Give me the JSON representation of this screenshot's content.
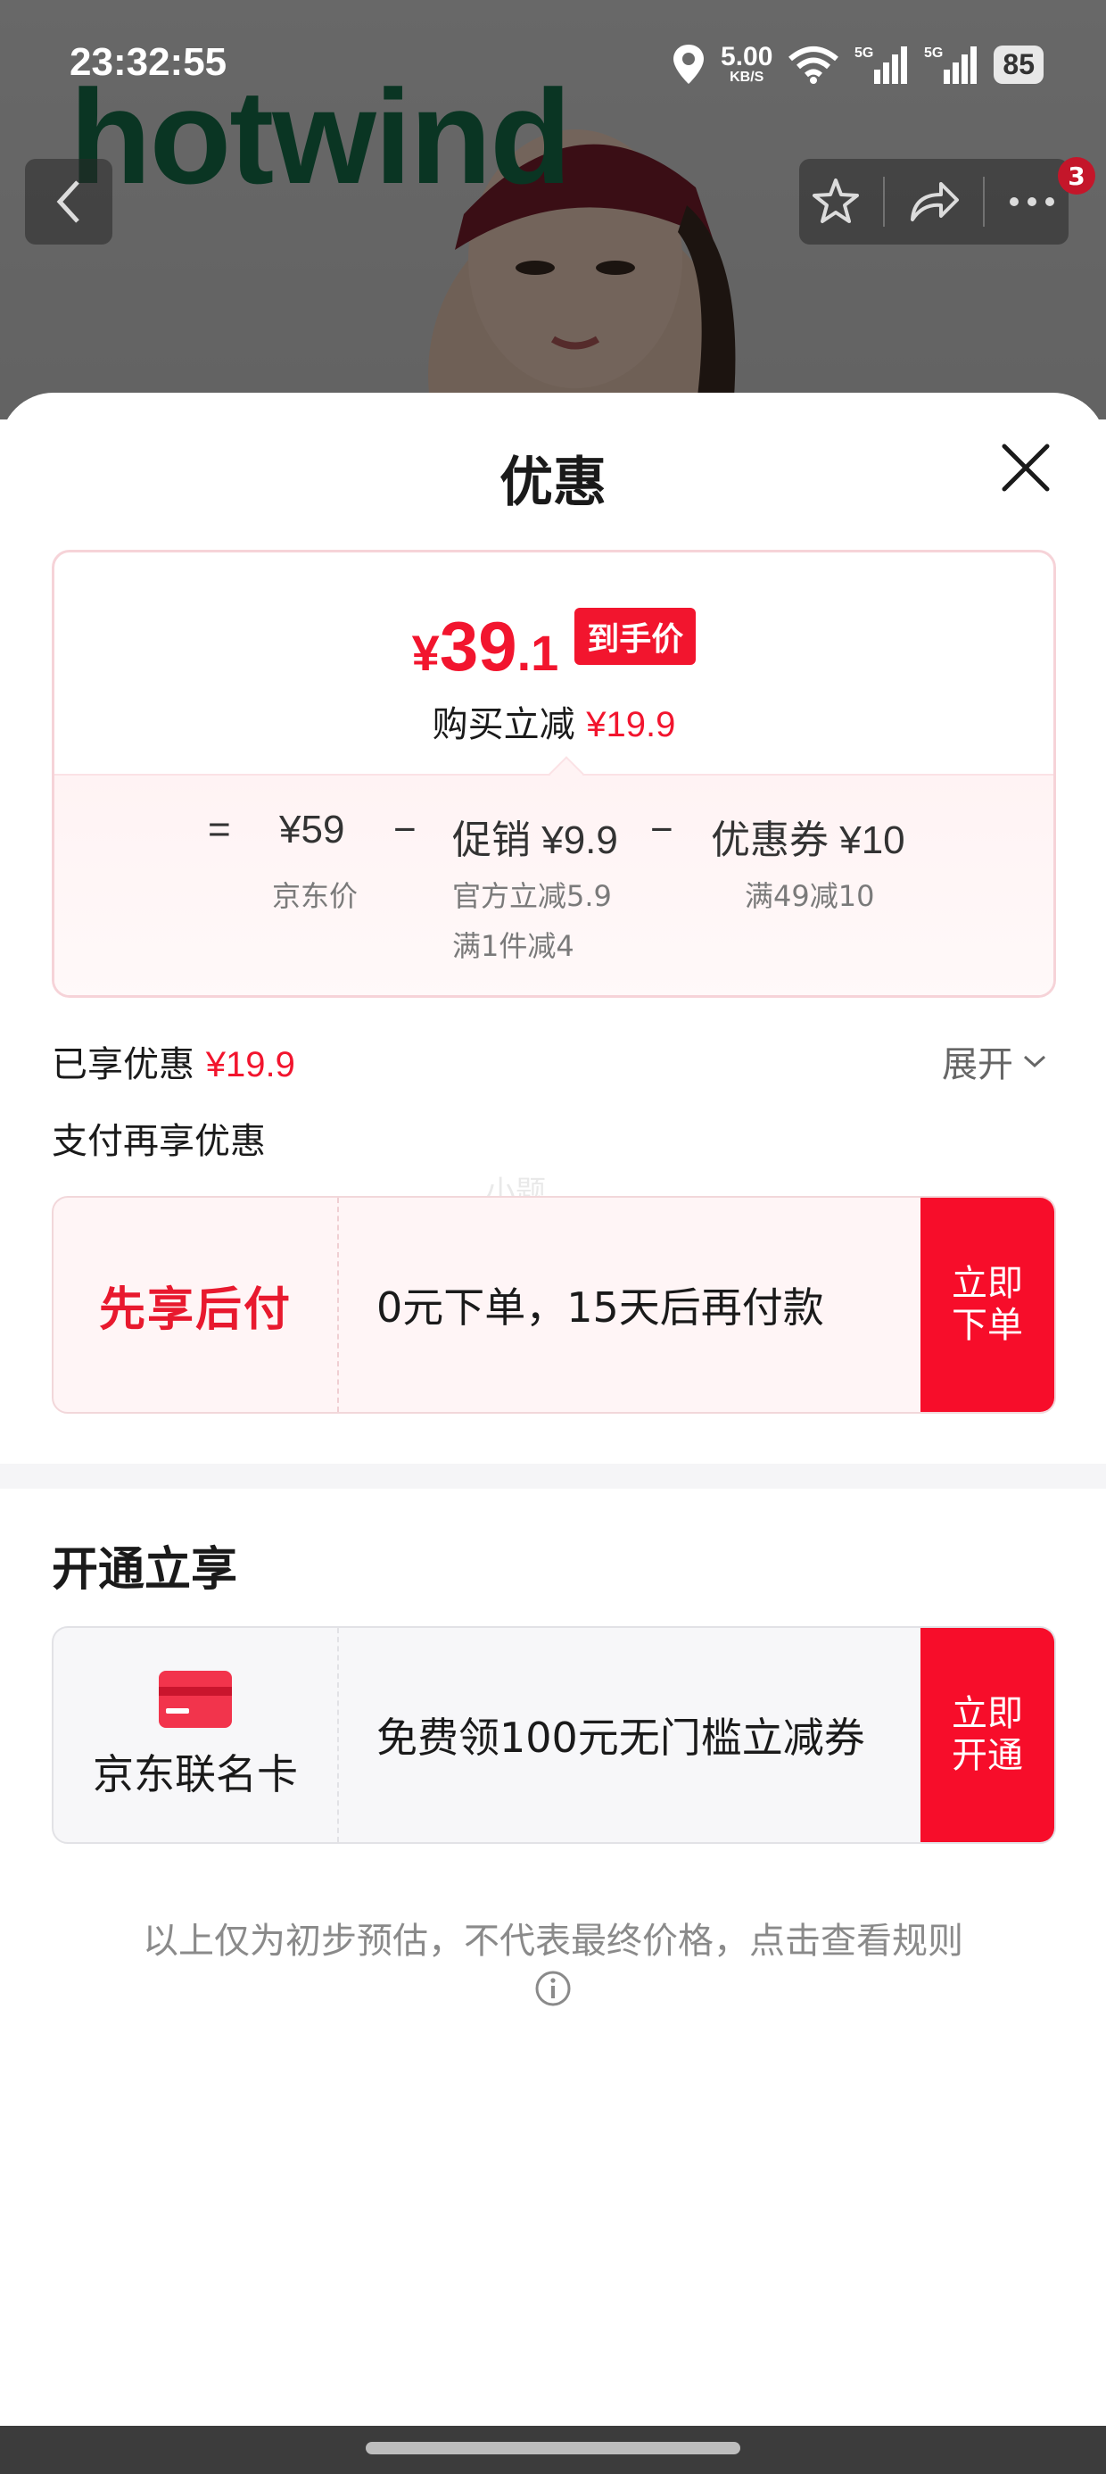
{
  "status_bar": {
    "time": "23:32:55",
    "net_speed": "5.00",
    "net_unit": "KB/S",
    "signal_1": "5G",
    "signal_2": "5G",
    "battery": "85"
  },
  "background": {
    "brand_logo": "hotwind",
    "notification_count": "3"
  },
  "sheet": {
    "title": "优惠",
    "price": {
      "currency": "¥",
      "integer": "39",
      "decimal": ".1",
      "tag": "到手价",
      "save_label": "购买立减",
      "save_amount": "¥19.9"
    },
    "formula": {
      "eq": "=",
      "base_price": "¥59",
      "base_label": "京东价",
      "minus_1": "−",
      "promo": "促销 ¥9.9",
      "promo_detail_1": "官方立减5.9",
      "promo_detail_2": "满1件减4",
      "minus_2": "−",
      "coupon": "优惠券 ¥10",
      "coupon_detail": "满49减10"
    },
    "enjoyed_label": "已享优惠",
    "enjoyed_amount": "¥19.9",
    "expand_label": "展开",
    "pay_more_label": "支付再享优惠",
    "watermark": "小题",
    "pay_later": {
      "brand": "先享后付",
      "desc": "0元下单，15天后再付款",
      "button_line1": "立即",
      "button_line2": "下单"
    },
    "open_title": "开通立享",
    "card_offer": {
      "name": "京东联名卡",
      "desc": "免费领100元无门槛立减券",
      "button_line1": "立即",
      "button_line2": "开通"
    },
    "footnote": "以上仅为初步预估，不代表最终价格，点击查看规则"
  },
  "colors": {
    "accent_red": "#f2152e",
    "button_red": "#f70d2a",
    "brand_green": "#16704a"
  }
}
